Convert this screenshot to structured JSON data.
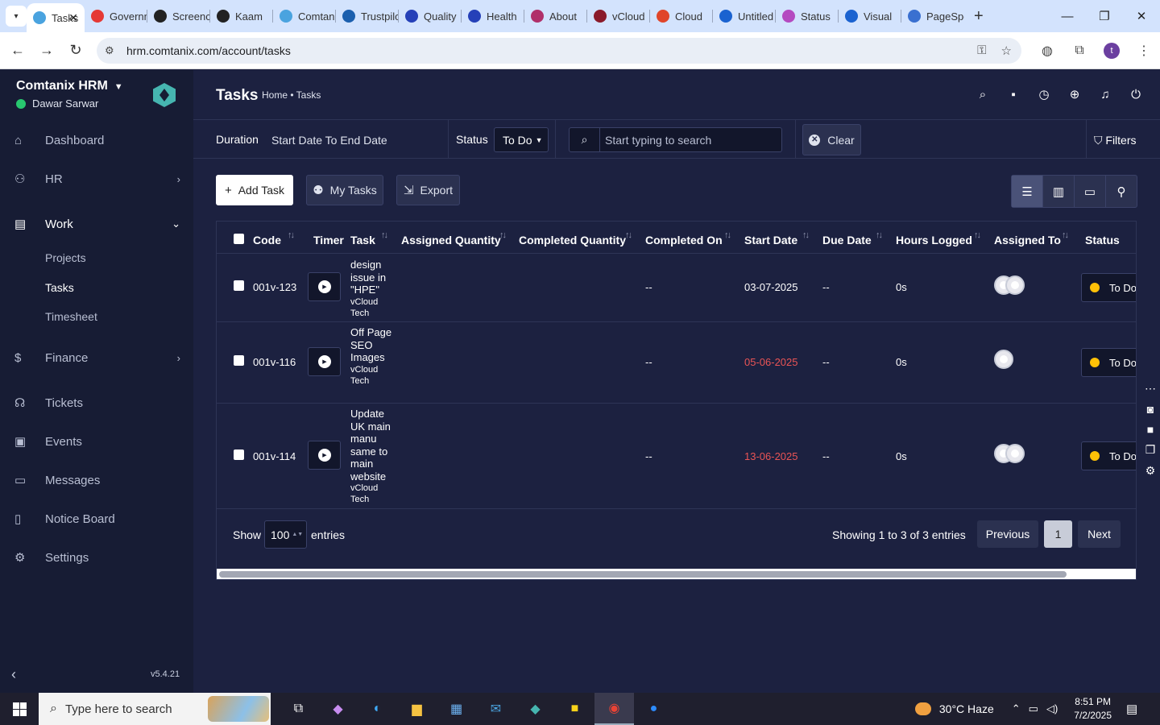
{
  "browser": {
    "tabs": [
      {
        "label": "Tasks",
        "color": "#4aa3df",
        "active": true
      },
      {
        "label": "Government",
        "color": "#e53935"
      },
      {
        "label": "Screencast",
        "color": "#222"
      },
      {
        "label": "Kaam",
        "color": "#222"
      },
      {
        "label": "Comtanix",
        "color": "#4aa3df"
      },
      {
        "label": "Trustpilot",
        "color": "#1b5fae"
      },
      {
        "label": "Quality",
        "color": "#2540b8"
      },
      {
        "label": "Health",
        "color": "#2540b8"
      },
      {
        "label": "About",
        "color": "#b0306a"
      },
      {
        "label": "vCloud",
        "color": "#8a1a2a"
      },
      {
        "label": "Cloud",
        "color": "#e0452a"
      },
      {
        "label": "Untitled",
        "color": "#1a62d0"
      },
      {
        "label": "Status",
        "color": "#b44ac0"
      },
      {
        "label": "Visual",
        "color": "#1a62d0"
      },
      {
        "label": "PageSpeed",
        "color": "#3a70d0"
      }
    ],
    "url": "hrm.comtanix.com/account/tasks",
    "profile_initial": "t"
  },
  "sidebar": {
    "brand": "Comtanix HRM",
    "user_name": "Dawar Sarwar",
    "menu": {
      "dashboard": "Dashboard",
      "hr": "HR",
      "work": "Work",
      "finance": "Finance",
      "tickets": "Tickets",
      "events": "Events",
      "messages": "Messages",
      "notice_board": "Notice Board",
      "settings": "Settings"
    },
    "work_sub": {
      "projects": "Projects",
      "tasks": "Tasks",
      "timesheet": "Timesheet"
    },
    "version": "v5.4.21"
  },
  "header": {
    "title": "Tasks",
    "breadcrumb": "Home • Tasks"
  },
  "filters": {
    "duration_label": "Duration",
    "duration_value": "Start Date To End Date",
    "status_label": "Status",
    "status_value": "To Do",
    "search_placeholder": "Start typing to search",
    "clear_label": "Clear",
    "filters_label": "Filters"
  },
  "actions": {
    "add_task": "Add Task",
    "my_tasks": "My Tasks",
    "export": "Export"
  },
  "table": {
    "columns": {
      "code": "Code",
      "timer": "Timer",
      "task": "Task",
      "assigned_quantity": "Assigned Quantity",
      "completed_quantity": "Completed Quantity",
      "completed_on": "Completed On",
      "start_date": "Start Date",
      "due_date": "Due Date",
      "hours_logged": "Hours Logged",
      "assigned_to": "Assigned To",
      "status": "Status"
    },
    "rows": [
      {
        "code": "001v-123",
        "task": "design issue in \"HPE\"",
        "project": "vCloud Tech",
        "completed_on": "--",
        "start_date": "03-07-2025",
        "due_date": "--",
        "hours": "0s",
        "status": "To Do"
      },
      {
        "code": "001v-116",
        "task": "Off Page SEO Images",
        "project": "vCloud Tech",
        "completed_on": "--",
        "start_date": "05-06-2025",
        "due_date": "--",
        "hours": "0s",
        "status": "To Do"
      },
      {
        "code": "001v-114",
        "task": "Update UK main manu same to main website",
        "project": "vCloud Tech",
        "completed_on": "--",
        "start_date": "13-06-2025",
        "due_date": "--",
        "hours": "0s",
        "status": "To Do"
      }
    ],
    "show_label": "Show",
    "page_size": "100",
    "entries_label": "entries",
    "showing_text": "Showing 1 to 3 of 3 entries",
    "previous": "Previous",
    "current_page": "1",
    "next": "Next"
  },
  "taskbar": {
    "search_placeholder": "Type here to search",
    "weather": "30°C  Haze",
    "time": "8:51 PM",
    "date": "7/2/2025"
  },
  "colors": {
    "sidebar_bg": "#171c34",
    "main_bg": "#1c2140",
    "overdue": "#ea5455",
    "status_todo": "#ffc107",
    "online": "#28c76f"
  }
}
